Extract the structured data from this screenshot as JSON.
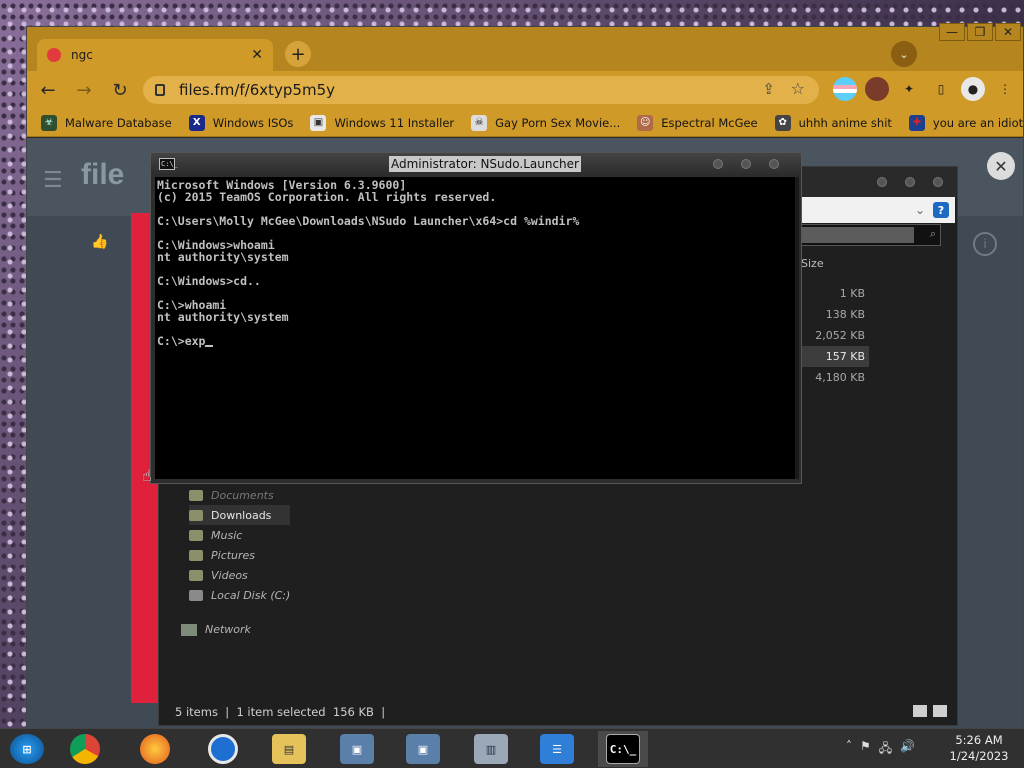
{
  "browser": {
    "tab_title": "ngc",
    "new_tab": "+",
    "url": "files.fm/f/6xtyp5m5y",
    "bookmarks": [
      {
        "label": "Malware Database",
        "icon": "virus-icon"
      },
      {
        "label": "Windows ISOs",
        "icon": "x-icon"
      },
      {
        "label": "Windows 11 Installer",
        "icon": "installer-icon"
      },
      {
        "label": "Gay Porn Sex Movie...",
        "icon": "skull-icon"
      },
      {
        "label": "Espectral McGee",
        "icon": "avatar-icon"
      },
      {
        "label": "uhhh anime shit",
        "icon": "anime-icon"
      },
      {
        "label": "you are an idiot!",
        "icon": "flag-icon"
      }
    ]
  },
  "console": {
    "title": "Administrator: NSudo.Launcher",
    "icon_text": "C:\\_",
    "lines": [
      "Microsoft Windows [Version 6.3.9600]",
      "(c) 2015 TeamOS Corporation. All rights reserved.",
      "",
      "C:\\Users\\Molly McGee\\Downloads\\NSudo Launcher\\x64>cd %windir%",
      "",
      "C:\\Windows>whoami",
      "nt authority\\system",
      "",
      "C:\\Windows>cd..",
      "",
      "C:\\>whoami",
      "nt authority\\system",
      ""
    ],
    "prompt_line": "C:\\>exp"
  },
  "explorer": {
    "size_header": "Size",
    "sizes": [
      "1 KB",
      "138 KB",
      "2,052 KB",
      "157 KB",
      "4,180 KB"
    ],
    "selected_index": 3,
    "nav_items": [
      "Documents",
      "Downloads",
      "Music",
      "Pictures",
      "Videos",
      "Local Disk (C:)"
    ],
    "network": "Network",
    "status": "5 items  |  1 item selected  156 KB  |"
  },
  "taskbar": {
    "time": "5:26 AM",
    "date": "1/24/2023"
  }
}
